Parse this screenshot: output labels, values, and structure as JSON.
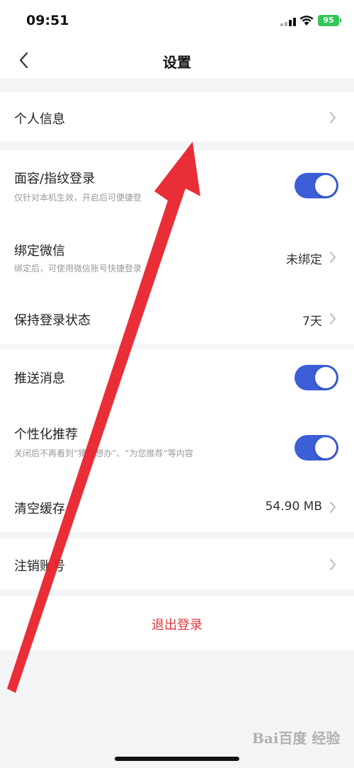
{
  "status_bar": {
    "time": "09:51",
    "battery": "95"
  },
  "header": {
    "title": "设置"
  },
  "settings": {
    "personal_info": {
      "label": "个人信息"
    },
    "face_login": {
      "label": "面容/指纹登录",
      "desc": "仅针对本机生效，开启后可便捷登",
      "enabled": true
    },
    "bind_wechat": {
      "label": "绑定微信",
      "desc": "绑定后，可使用微信账号快捷登录",
      "value": "未绑定"
    },
    "keep_login": {
      "label": "保持登录状态",
      "value": "7天"
    },
    "push": {
      "label": "推送消息",
      "enabled": true
    },
    "personalized": {
      "label": "个性化推荐",
      "desc": "关闭后不再看到“猜你想办”、“为您推荐”等内容",
      "enabled": true
    },
    "clear_cache": {
      "label": "清空缓存",
      "value": "54.90 MB"
    },
    "cancel_account": {
      "label": "注销账号"
    }
  },
  "logout": {
    "label": "退出登录"
  },
  "watermark": {
    "text": "Bai百度 经验"
  },
  "colors": {
    "accent": "#3c5ed6",
    "logout": "#e0393e",
    "annotation_arrow": "#e8212b"
  }
}
